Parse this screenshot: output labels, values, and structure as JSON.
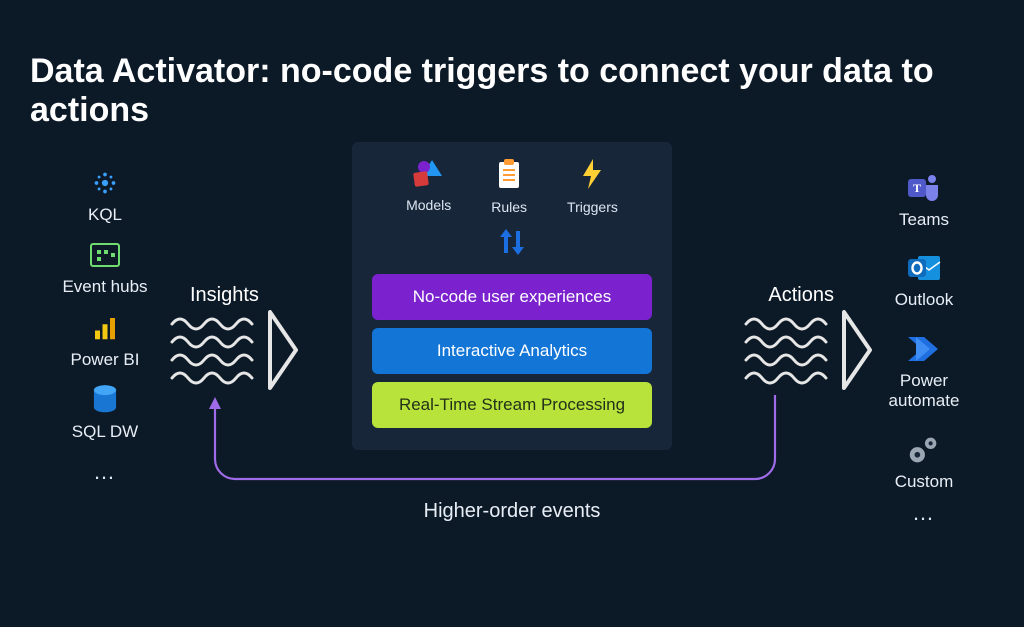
{
  "title": "Data Activator: no-code triggers to connect your data to actions",
  "sources": {
    "items": [
      {
        "label": "KQL"
      },
      {
        "label": "Event hubs"
      },
      {
        "label": "Power BI"
      },
      {
        "label": "SQL DW"
      }
    ],
    "more": "…"
  },
  "targets": {
    "items": [
      {
        "label": "Teams"
      },
      {
        "label": "Outlook"
      },
      {
        "label": "Power automate"
      },
      {
        "label": "Custom"
      }
    ],
    "more": "…"
  },
  "flow": {
    "insights_label": "Insights",
    "actions_label": "Actions",
    "higher_order_label": "Higher-order events"
  },
  "center": {
    "top": {
      "models": "Models",
      "rules": "Rules",
      "triggers": "Triggers"
    },
    "bars": {
      "nocode": "No-code user experiences",
      "analytics": "Interactive Analytics",
      "stream": "Real-Time Stream Processing"
    }
  }
}
